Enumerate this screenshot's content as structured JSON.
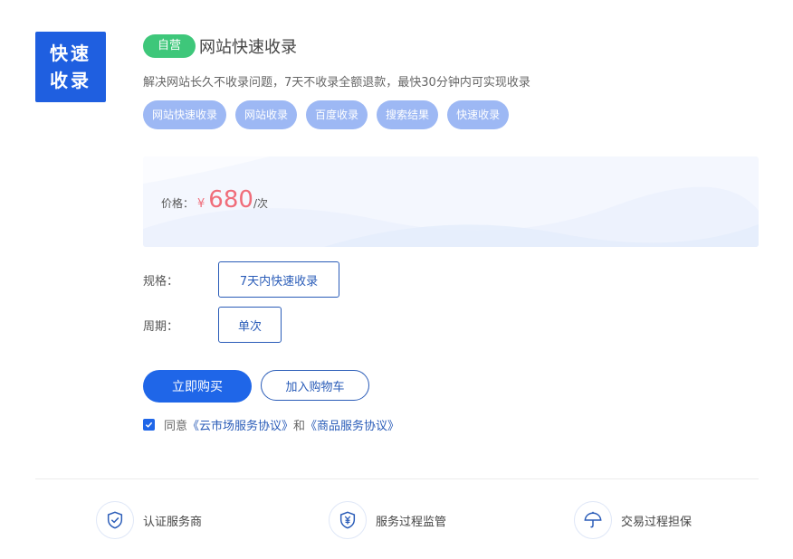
{
  "logo": {
    "line1": "快速",
    "line2": "收录"
  },
  "product": {
    "badge": "自营",
    "title": "网站快速收录",
    "description": "解决网站长久不收录问题，7天不收录全额退款，最快30分钟内可实现收录",
    "tags": [
      "网站快速收录",
      "网站收录",
      "百度收录",
      "搜索结果",
      "快速收录"
    ]
  },
  "price": {
    "label": "价格：",
    "currency": "¥",
    "value": "680",
    "unit": "/次"
  },
  "spec": {
    "label": "规格：",
    "option": "7天内快速收录"
  },
  "period": {
    "label": "周期：",
    "option": "单次"
  },
  "actions": {
    "buy": "立即购买",
    "cart": "加入购物车"
  },
  "agreement": {
    "prefix": "同意",
    "link1": "《云市场服务协议》",
    "and": "和",
    "link2": "《商品服务协议》",
    "checked": true
  },
  "features": [
    {
      "icon": "shield-check-icon",
      "label": "认证服务商"
    },
    {
      "icon": "shield-yen-icon",
      "label": "服务过程监管"
    },
    {
      "icon": "umbrella-icon",
      "label": "交易过程担保"
    }
  ],
  "colors": {
    "accent": "#1f66e8",
    "badge": "#3ec77a",
    "tag": "#9db8f4",
    "price": "#f06d7a",
    "logo": "#1f5fe0"
  }
}
